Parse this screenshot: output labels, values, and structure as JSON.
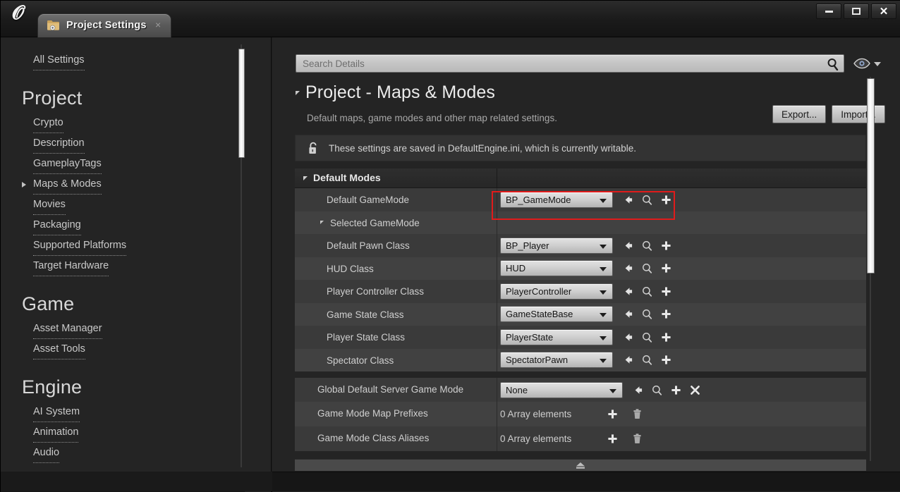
{
  "window": {
    "logo": "ue-logo",
    "tab": {
      "title": "Project Settings",
      "folder_icon": "folder-gear-icon",
      "close": "×"
    },
    "controls": {
      "minimize": "minimize-icon",
      "maximize": "maximize-icon",
      "close": "close-icon"
    }
  },
  "sidebar": {
    "top_link": "All Settings",
    "groups": [
      {
        "title": "Project",
        "items": [
          {
            "label": "Crypto",
            "expandable": false
          },
          {
            "label": "Description",
            "expandable": false
          },
          {
            "label": "GameplayTags",
            "expandable": false
          },
          {
            "label": "Maps & Modes",
            "expandable": true
          },
          {
            "label": "Movies",
            "expandable": false
          },
          {
            "label": "Packaging",
            "expandable": false
          },
          {
            "label": "Supported Platforms",
            "expandable": false
          },
          {
            "label": "Target Hardware",
            "expandable": false
          }
        ]
      },
      {
        "title": "Game",
        "items": [
          {
            "label": "Asset Manager",
            "expandable": false
          },
          {
            "label": "Asset Tools",
            "expandable": false
          }
        ]
      },
      {
        "title": "Engine",
        "items": [
          {
            "label": "AI System",
            "expandable": false
          },
          {
            "label": "Animation",
            "expandable": false
          },
          {
            "label": "Audio",
            "expandable": false
          }
        ]
      }
    ]
  },
  "search": {
    "placeholder": "Search Details",
    "value": "",
    "magnifier_icon": "search-icon",
    "eye_icon": "eye-icon",
    "caret_icon": "chevron-down-icon"
  },
  "page": {
    "title": "Project - Maps & Modes",
    "subtitle": "Default maps, game modes and other map related settings.",
    "export_label": "Export...",
    "import_label": "Import..."
  },
  "notice": {
    "icon": "unlocked-padlock-icon",
    "text": "These settings are saved in DefaultEngine.ini, which is currently writable."
  },
  "details": {
    "category": "Default Modes",
    "rows": [
      {
        "label": "Default GameMode",
        "indent": 1,
        "type": "combo",
        "value": "BP_GameMode",
        "highlighted": true,
        "icons": [
          "reset-arrow-icon",
          "browse-magnifier-icon",
          "add-plus-icon"
        ]
      },
      {
        "label": "Selected GameMode",
        "indent": 1,
        "type": "group",
        "expandable": true
      },
      {
        "label": "Default Pawn Class",
        "indent": 2,
        "type": "combo",
        "value": "BP_Player",
        "icons": [
          "reset-arrow-icon",
          "browse-magnifier-icon",
          "add-plus-icon"
        ]
      },
      {
        "label": "HUD Class",
        "indent": 2,
        "type": "combo",
        "value": "HUD",
        "icons": [
          "reset-arrow-icon",
          "browse-magnifier-icon",
          "add-plus-icon"
        ]
      },
      {
        "label": "Player Controller Class",
        "indent": 2,
        "type": "combo",
        "value": "PlayerController",
        "icons": [
          "reset-arrow-icon",
          "browse-magnifier-icon",
          "add-plus-icon"
        ]
      },
      {
        "label": "Game State Class",
        "indent": 2,
        "type": "combo",
        "value": "GameStateBase",
        "icons": [
          "reset-arrow-icon",
          "browse-magnifier-icon",
          "add-plus-icon"
        ]
      },
      {
        "label": "Player State Class",
        "indent": 2,
        "type": "combo",
        "value": "PlayerState",
        "icons": [
          "reset-arrow-icon",
          "browse-magnifier-icon",
          "add-plus-icon"
        ]
      },
      {
        "label": "Spectator Class",
        "indent": 2,
        "type": "combo",
        "value": "SpectatorPawn",
        "icons": [
          "reset-arrow-icon",
          "browse-magnifier-icon",
          "add-plus-icon"
        ]
      }
    ],
    "rows2": [
      {
        "label": "Global Default Server Game Mode",
        "indent": 3,
        "type": "combo",
        "value": "None",
        "icons": [
          "reset-arrow-icon",
          "browse-magnifier-icon",
          "add-plus-icon",
          "clear-x-icon"
        ]
      },
      {
        "label": "Game Mode Map Prefixes",
        "indent": 3,
        "type": "array",
        "value": "0 Array elements",
        "icons": [
          "add-plus-icon",
          "delete-trash-icon"
        ]
      },
      {
        "label": "Game Mode Class Aliases",
        "indent": 3,
        "type": "array",
        "value": "0 Array elements",
        "icons": [
          "add-plus-icon",
          "delete-trash-icon"
        ]
      }
    ]
  },
  "footer": {
    "eject_icon": "eject-collapse-icon"
  },
  "colors": {
    "highlight": "#e01b1b",
    "panel_bg": "#242424",
    "row_bg": "#3a3a3a",
    "row_alt_bg": "#414141"
  }
}
